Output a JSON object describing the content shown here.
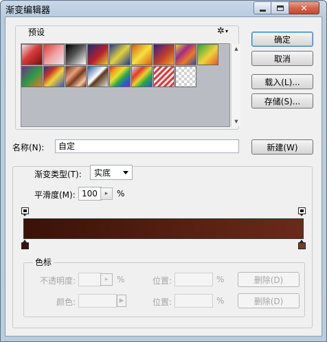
{
  "window": {
    "title": "渐变编辑器",
    "close_glyph": "✕"
  },
  "presets": {
    "legend": "预设",
    "gear_glyph": "✲",
    "scroll_up_glyph": "▲",
    "scroll_down_glyph": "▼",
    "swatches": [
      {
        "kind": "black-red",
        "bg": "linear-gradient(135deg,#e8e8e8 0%,#d83a3a 45%,#7a0e0e 100%)"
      },
      {
        "kind": "red-transparent",
        "bg": "linear-gradient(135deg,#e23b3b 0%,#f0a0a0 50%,#e6e6e6 100%)"
      },
      {
        "kind": "black-white",
        "bg": "linear-gradient(135deg,#000 0%,#555 45%,#fff 100%)"
      },
      {
        "kind": "blue-red-yellow",
        "bg": "linear-gradient(135deg,#202a7a 0%,#b8202a 55%,#e3d030 100%)"
      },
      {
        "kind": "blue-yellow-blue",
        "bg": "linear-gradient(135deg,#1f3a98 0%,#e4d23a 50%,#1f3a98 100%)"
      },
      {
        "kind": "orange-yellow-orange",
        "bg": "linear-gradient(135deg,#d85a12 0%,#f4e23c 50%,#d85a12 100%)"
      },
      {
        "kind": "violet-orange",
        "bg": "linear-gradient(135deg,#3a1a8a 0%,#c1402a 55%,#f2a324 100%)"
      },
      {
        "kind": "yellow-violet-orange-blue",
        "bg": "linear-gradient(135deg,#e8d234 0%,#a22a8c 35%,#ee7a22 65%,#2a4ab4 100%)"
      },
      {
        "kind": "green-transparent",
        "bg": "linear-gradient(135deg,#2aa53c 0%,#f2d23a 55%,#e05a2a 100%)"
      },
      {
        "kind": "violet-green-orange",
        "bg": "linear-gradient(135deg,#7a2a8c 0%,#2a9a4a 50%,#e8792a 100%)"
      },
      {
        "kind": "stripes-violet-yellow",
        "bg": "linear-gradient(135deg,#3b2a8c 0%,#c2342a 30%,#f0d23a 55%,#3a5ab0 100%)"
      },
      {
        "kind": "copper",
        "bg": "linear-gradient(135deg,#6b2e1a 0%,#e8a07a 35%,#7a3a22 55%,#f4c49a 80%,#6b2e1a 100%)"
      },
      {
        "kind": "chrome",
        "bg": "linear-gradient(135deg,#2a5ca8 0%,#ffffff 45%,#5a3a1a 55%,#e0e0e0 100%)"
      },
      {
        "kind": "spectrum",
        "bg": "linear-gradient(135deg,#e22a2a 0%,#f0a020 20%,#e8e030 40%,#2aa84a 60%,#2a5ad0 80%,#8a2ab8 100%)"
      },
      {
        "kind": "transparent-rainbow",
        "bg": "linear-gradient(135deg,#e0e0e0 0%,#e23a2a 30%,#e8d22a 50%,#2aa84a 70%,#2a5ad0 100%)"
      },
      {
        "kind": "transparent-stripes",
        "bg": "repeating-linear-gradient(135deg,#e03a3a 0px,#e03a3a 3px,#f0f0f0 3px,#f0f0f0 6px)"
      },
      {
        "kind": "neutral-density",
        "bg": "repeating-conic-gradient(#d0d0d0 0% 25%,#ffffff 0% 50%) 0 0 / 8px 8px"
      }
    ]
  },
  "buttons": {
    "ok": "确定",
    "cancel": "取消",
    "load": "载入(L)...",
    "save": "存储(S)...",
    "new": "新建(W)",
    "delete_opacity": "删除(D)",
    "delete_color": "删除(D)"
  },
  "name_field": {
    "label": "名称(N):",
    "value": "自定"
  },
  "gradient_type": {
    "label": "渐变类型(T):",
    "value": "实底"
  },
  "smoothness": {
    "label": "平滑度(M):",
    "value": "100",
    "unit": "%",
    "stepper_glyph": "▸"
  },
  "gradient": {
    "start_color": "#3a1208",
    "end_color": "#6a2a1a",
    "left_stop_color": "#3a1208",
    "right_stop_color": "#7a3a2a"
  },
  "stops_group": {
    "legend": "色标",
    "opacity_label": "不透明度:",
    "opacity_unit": "%",
    "opacity_stepper_glyph": "▸",
    "location_label_1": "位置:",
    "location_unit_1": "%",
    "color_label": "颜色:",
    "color_arrow_glyph": "▶",
    "location_label_2": "位置:",
    "location_unit_2": "%"
  }
}
